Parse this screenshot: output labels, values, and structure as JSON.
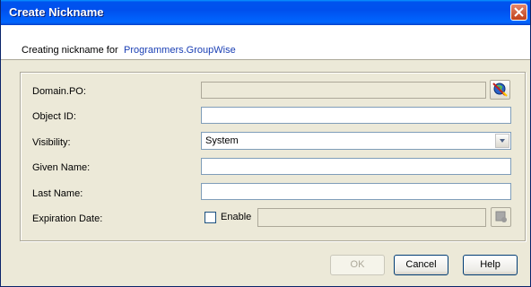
{
  "window": {
    "title": "Create Nickname"
  },
  "header": {
    "label": "Creating nickname for",
    "target": "Programmers.GroupWise"
  },
  "form": {
    "domain_po": {
      "label": "Domain.PO:",
      "value": ""
    },
    "object_id": {
      "label": "Object ID:",
      "value": ""
    },
    "visibility": {
      "label": "Visibility:",
      "value": "System"
    },
    "given_name": {
      "label": "Given Name:",
      "value": ""
    },
    "last_name": {
      "label": "Last Name:",
      "value": ""
    },
    "expiration": {
      "label": "Expiration Date:",
      "enable_label": "Enable",
      "enabled": false,
      "value": ""
    }
  },
  "buttons": {
    "ok": "OK",
    "cancel": "Cancel",
    "help": "Help"
  },
  "colors": {
    "title_blue": "#0053ee",
    "link": "#1a3fb4",
    "dialog_bg": "#ece9d8",
    "close_red": "#c1411a"
  }
}
